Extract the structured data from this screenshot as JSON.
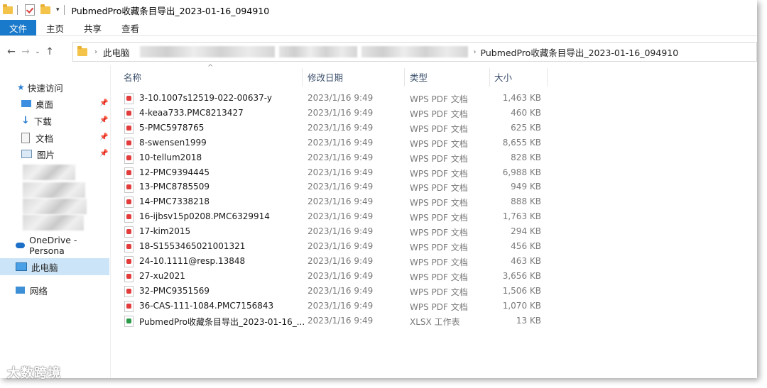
{
  "window": {
    "title": "PubmedPro收藏条目导出_2023-01-16_094910"
  },
  "ribbon": {
    "tabs": [
      "文件",
      "主页",
      "共享",
      "查看"
    ]
  },
  "address": {
    "root": "此电脑",
    "current": "PubmedPro收藏条目导出_2023-01-16_094910"
  },
  "sidebar": {
    "quick_access": "快速访问",
    "items": [
      "桌面",
      "下载",
      "文档",
      "图片"
    ],
    "onedrive": "OneDrive - Persona",
    "this_pc": "此电脑",
    "network": "网络"
  },
  "columns": {
    "name": "名称",
    "date": "修改日期",
    "type": "类型",
    "size": "大小"
  },
  "files": [
    {
      "name": "3-10.1007s12519-022-00637-y",
      "date": "2023/1/16 9:49",
      "type": "WPS PDF 文档",
      "size": "1,463 KB",
      "icon": "pdf"
    },
    {
      "name": "4-keaa733.PMC8213427",
      "date": "2023/1/16 9:49",
      "type": "WPS PDF 文档",
      "size": "460 KB",
      "icon": "pdf"
    },
    {
      "name": "5-PMC5978765",
      "date": "2023/1/16 9:49",
      "type": "WPS PDF 文档",
      "size": "625 KB",
      "icon": "pdf"
    },
    {
      "name": "8-swensen1999",
      "date": "2023/1/16 9:49",
      "type": "WPS PDF 文档",
      "size": "8,655 KB",
      "icon": "pdf"
    },
    {
      "name": "10-tellum2018",
      "date": "2023/1/16 9:49",
      "type": "WPS PDF 文档",
      "size": "828 KB",
      "icon": "pdf"
    },
    {
      "name": "12-PMC9394445",
      "date": "2023/1/16 9:49",
      "type": "WPS PDF 文档",
      "size": "6,988 KB",
      "icon": "pdf"
    },
    {
      "name": "13-PMC8785509",
      "date": "2023/1/16 9:49",
      "type": "WPS PDF 文档",
      "size": "949 KB",
      "icon": "pdf"
    },
    {
      "name": "14-PMC7338218",
      "date": "2023/1/16 9:49",
      "type": "WPS PDF 文档",
      "size": "888 KB",
      "icon": "pdf"
    },
    {
      "name": "16-ijbsv15p0208.PMC6329914",
      "date": "2023/1/16 9:49",
      "type": "WPS PDF 文档",
      "size": "1,763 KB",
      "icon": "pdf"
    },
    {
      "name": "17-kim2015",
      "date": "2023/1/16 9:49",
      "type": "WPS PDF 文档",
      "size": "294 KB",
      "icon": "pdf"
    },
    {
      "name": "18-S1553465021001321",
      "date": "2023/1/16 9:49",
      "type": "WPS PDF 文档",
      "size": "456 KB",
      "icon": "pdf"
    },
    {
      "name": "24-10.1111@resp.13848",
      "date": "2023/1/16 9:49",
      "type": "WPS PDF 文档",
      "size": "463 KB",
      "icon": "pdf"
    },
    {
      "name": "27-xu2021",
      "date": "2023/1/16 9:49",
      "type": "WPS PDF 文档",
      "size": "3,656 KB",
      "icon": "pdf"
    },
    {
      "name": "32-PMC9351569",
      "date": "2023/1/16 9:49",
      "type": "WPS PDF 文档",
      "size": "1,506 KB",
      "icon": "pdf"
    },
    {
      "name": "36-CAS-111-1084.PMC7156843",
      "date": "2023/1/16 9:49",
      "type": "WPS PDF 文档",
      "size": "1,070 KB",
      "icon": "pdf"
    },
    {
      "name": "PubmedPro收藏条目导出_2023-01-16_...",
      "date": "2023/1/16 9:49",
      "type": "XLSX 工作表",
      "size": "13 KB",
      "icon": "xlsx"
    }
  ],
  "watermark": "大数跨境",
  "colors": {
    "file_tab": "#1979ca",
    "selected": "#cce4f7"
  }
}
